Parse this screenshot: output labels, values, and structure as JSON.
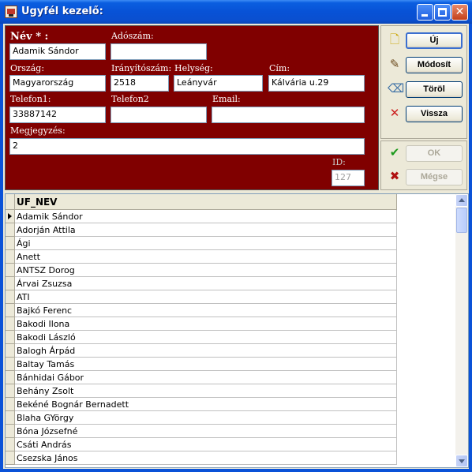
{
  "window": {
    "title": "Ugyfél kezelő:"
  },
  "form": {
    "nev_label": "Név * :",
    "nev_value": "Adamik Sándor",
    "adoszam_label": "Adószám:",
    "adoszam_value": "",
    "orszag_label": "Ország:",
    "orszag_value": "Magyarország",
    "irsz_label": "Irányítószám:",
    "irsz_value": "2518",
    "helyseg_label": "Helység:",
    "helyseg_value": "Leányvár",
    "cim_label": "Cím:",
    "cim_value": "Kálvária u.29",
    "telefon1_label": "Telefon1:",
    "telefon1_value": "33887142",
    "telefon2_label": "Telefon2",
    "telefon2_value": "",
    "email_label": "Email:",
    "email_value": "",
    "megjegyzes_label": "Megjegyzés:",
    "megjegyzes_value": "2",
    "id_label": "ID:",
    "id_value": "127"
  },
  "actions": {
    "uj": "Új",
    "modosit": "Módosít",
    "torol": "Töröl",
    "vissza": "Vissza",
    "ok": "OK",
    "megse": "Mégse"
  },
  "grid": {
    "column": "UF_NEV",
    "rows": [
      "Adamik Sándor",
      "Adorján Attila",
      "Ági",
      "Anett",
      "ANTSZ Dorog",
      "Árvai Zsuzsa",
      "ATI",
      "Bajkó Ferenc",
      "Bakodi Ilona",
      "Bakodi László",
      "Balogh Árpád",
      "Baltay Tamás",
      "Bánhidai Gábor",
      "Behány Zsolt",
      "Bekéné Bognár Bernadett",
      "Blaha  GYörgy",
      "Bóna Józsefné",
      "Csáti András",
      "Csezska János"
    ]
  }
}
